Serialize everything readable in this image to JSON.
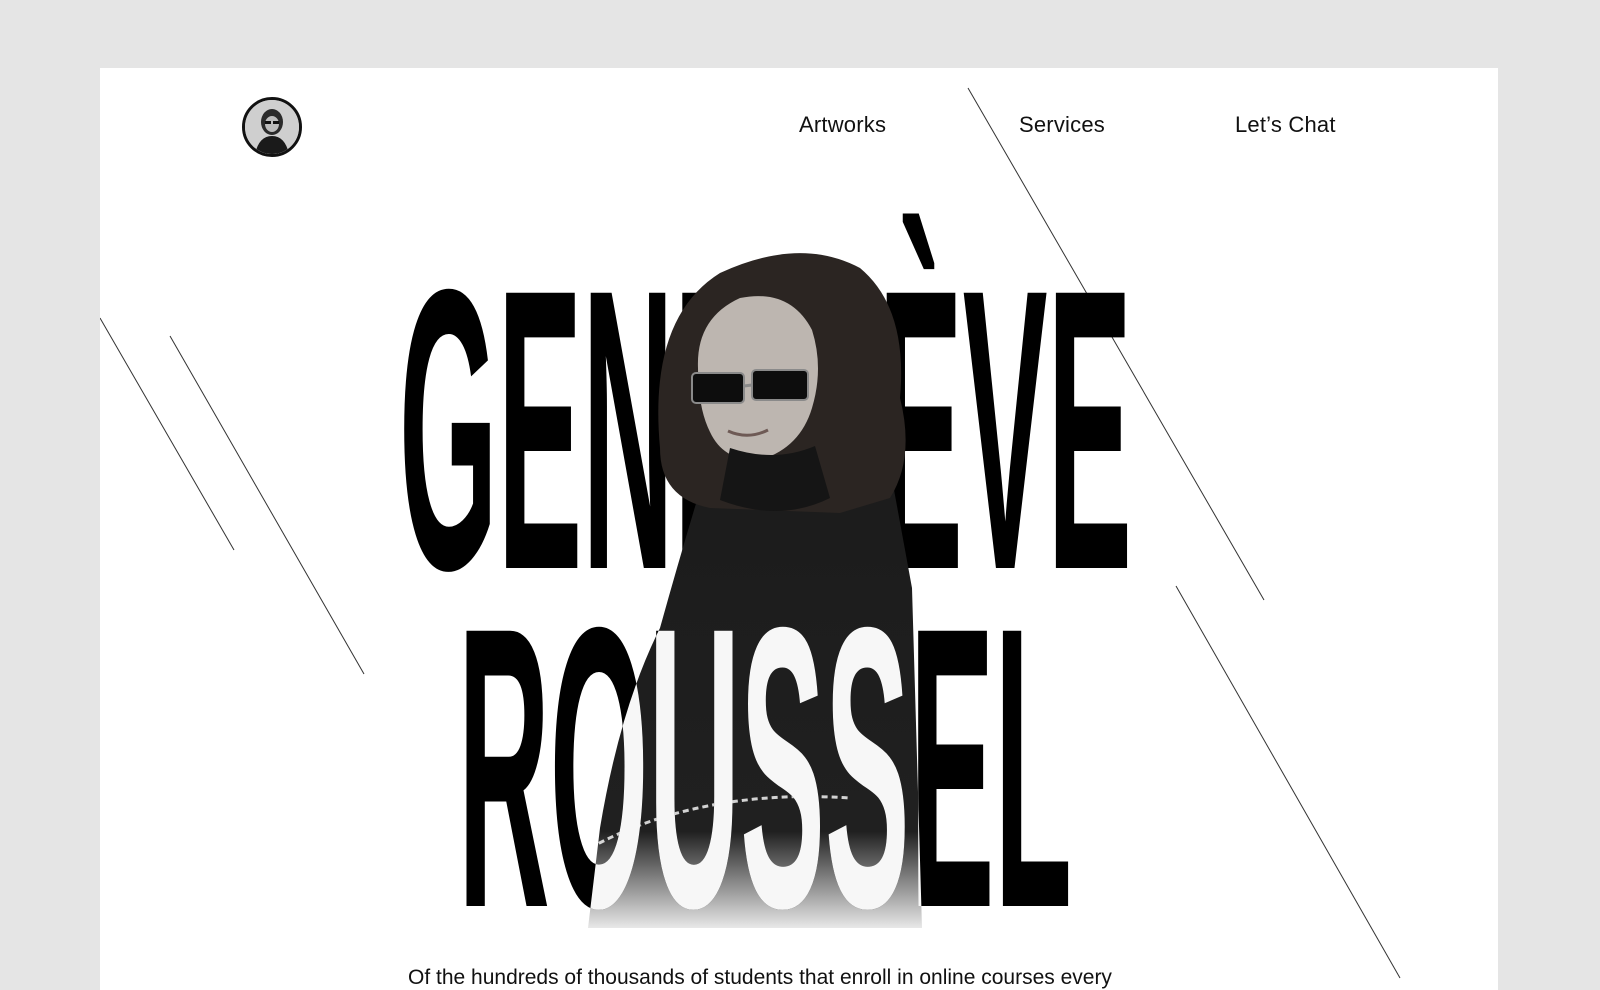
{
  "nav": {
    "items": [
      {
        "label": "Artworks"
      },
      {
        "label": "Services"
      },
      {
        "label": "Let’s Chat"
      }
    ]
  },
  "hero": {
    "first_name": "GENEVIÈVE",
    "last_name": "ROUSSEL",
    "tagline": "Of the hundreds of thousands of students that enroll in online courses every"
  },
  "colors": {
    "page_bg": "#e5e5e5",
    "card_bg": "#ffffff",
    "text": "#111111",
    "name_fill": "#000000"
  },
  "icons": {
    "avatar": "profile-photo-icon"
  }
}
